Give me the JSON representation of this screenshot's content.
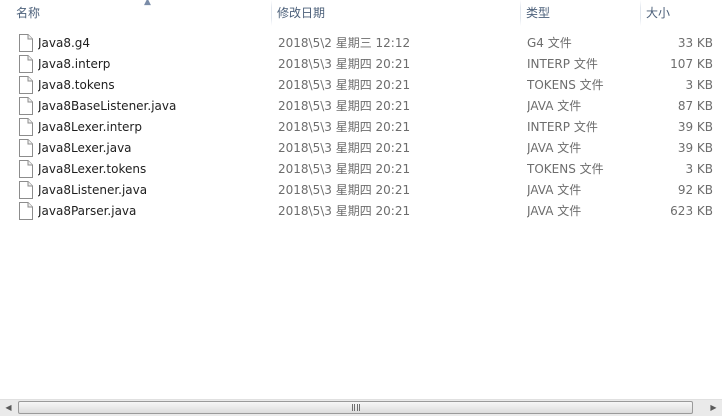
{
  "columns": {
    "name": "名称",
    "date": "修改日期",
    "type": "类型",
    "size": "大小"
  },
  "sort": {
    "column": "name",
    "direction": "ascending"
  },
  "files": [
    {
      "icon": "file-icon",
      "name": "Java8.g4",
      "date": "2018\\5\\2 星期三 12:12",
      "type": "G4 文件",
      "size": "33 KB"
    },
    {
      "icon": "file-icon",
      "name": "Java8.interp",
      "date": "2018\\5\\3 星期四 20:21",
      "type": "INTERP 文件",
      "size": "107 KB"
    },
    {
      "icon": "file-icon",
      "name": "Java8.tokens",
      "date": "2018\\5\\3 星期四 20:21",
      "type": "TOKENS 文件",
      "size": "3 KB"
    },
    {
      "icon": "file-icon",
      "name": "Java8BaseListener.java",
      "date": "2018\\5\\3 星期四 20:21",
      "type": "JAVA 文件",
      "size": "87 KB"
    },
    {
      "icon": "file-icon",
      "name": "Java8Lexer.interp",
      "date": "2018\\5\\3 星期四 20:21",
      "type": "INTERP 文件",
      "size": "39 KB"
    },
    {
      "icon": "file-icon",
      "name": "Java8Lexer.java",
      "date": "2018\\5\\3 星期四 20:21",
      "type": "JAVA 文件",
      "size": "39 KB"
    },
    {
      "icon": "file-icon",
      "name": "Java8Lexer.tokens",
      "date": "2018\\5\\3 星期四 20:21",
      "type": "TOKENS 文件",
      "size": "3 KB"
    },
    {
      "icon": "file-icon",
      "name": "Java8Listener.java",
      "date": "2018\\5\\3 星期四 20:21",
      "type": "JAVA 文件",
      "size": "92 KB"
    },
    {
      "icon": "file-icon",
      "name": "Java8Parser.java",
      "date": "2018\\5\\3 星期四 20:21",
      "type": "JAVA 文件",
      "size": "623 KB"
    }
  ],
  "scrollbar": {
    "left_icon": "scroll-left-arrow-icon",
    "right_icon": "scroll-right-arrow-icon",
    "grip_icon": "grip-icon"
  },
  "colors": {
    "header_text": "#4c607a",
    "name_text": "#1e1e1e",
    "detail_text": "#6d6d6d",
    "scrollbar_track": "#eaeaea"
  }
}
